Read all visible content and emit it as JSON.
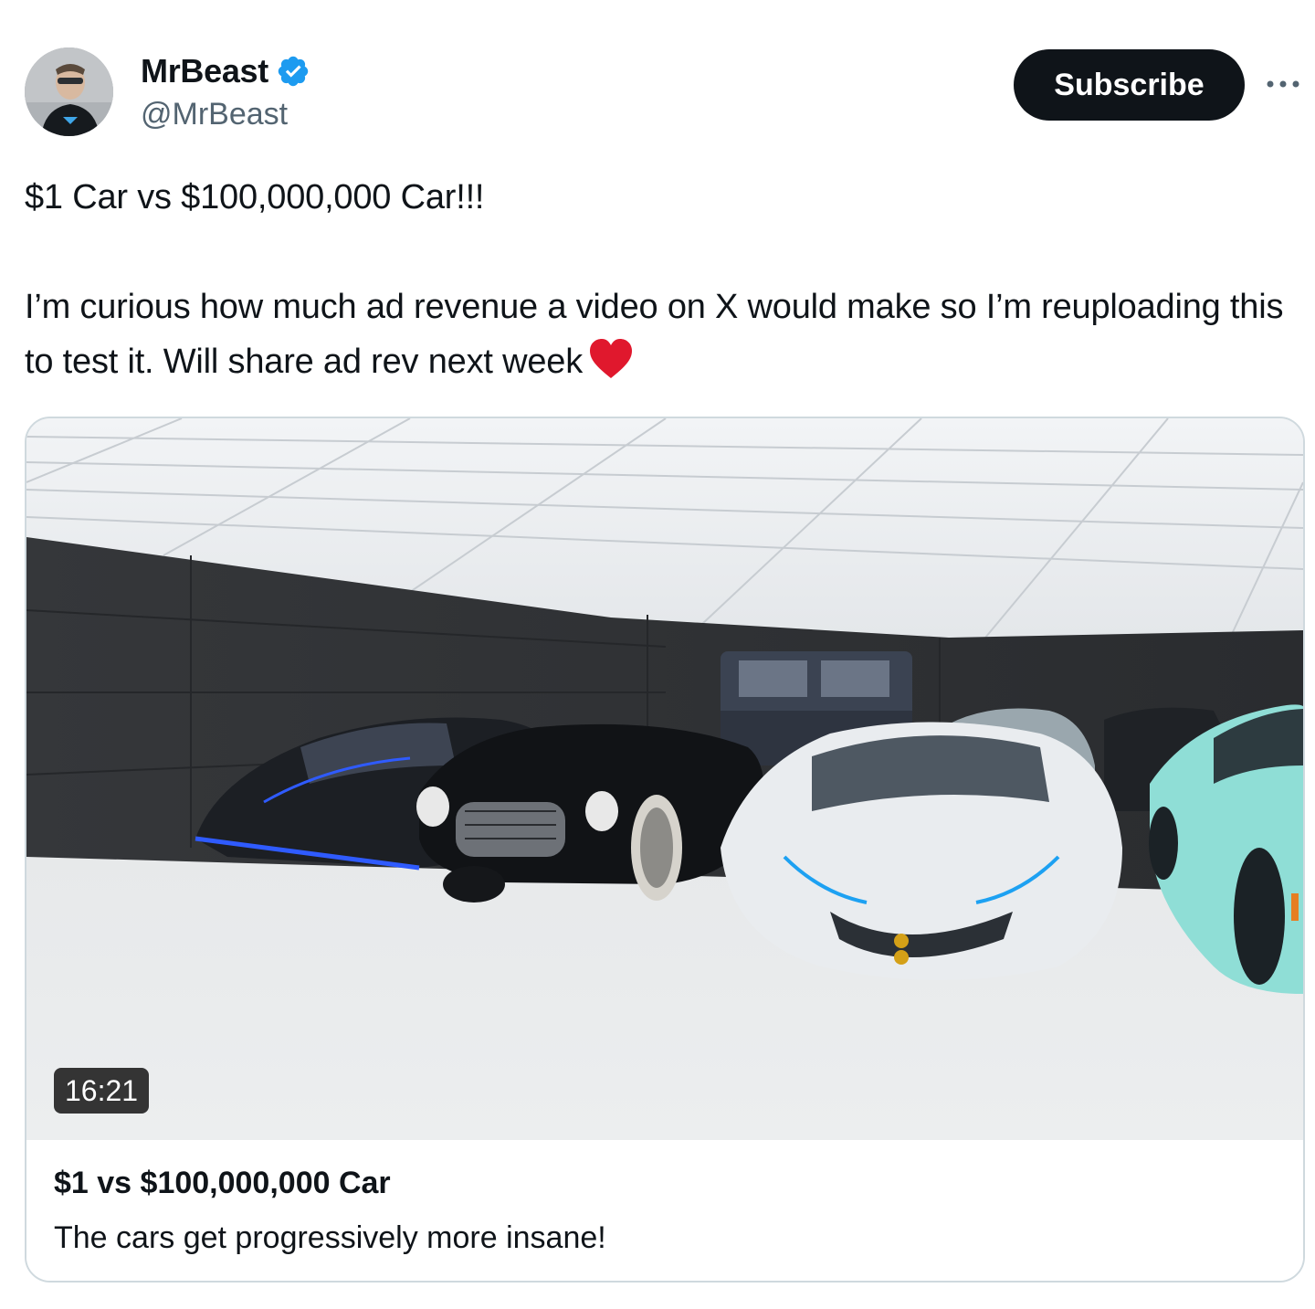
{
  "author": {
    "display_name": "MrBeast",
    "handle": "@MrBeast",
    "verified": true,
    "avatar_icon": "profile-photo"
  },
  "actions": {
    "subscribe_label": "Subscribe",
    "more_icon": "ellipsis-icon"
  },
  "tweet": {
    "line1": "$1 Car vs $100,000,000 Car!!!",
    "line2": "I’m curious how much ad revenue a video on X would make so I’m reuploading this to test it. Will share ad rev next week",
    "emoji": "heart-icon"
  },
  "video_card": {
    "duration": "16:21",
    "title": "$1 vs $100,000,000 Car",
    "description": "The cars get progressively more insane!"
  },
  "colors": {
    "text_primary": "#0f1419",
    "text_secondary": "#536471",
    "verified_blue": "#1d9bf0",
    "button_bg": "#0f1419",
    "heart_red": "#e0182d",
    "card_border": "#cfd9de"
  }
}
